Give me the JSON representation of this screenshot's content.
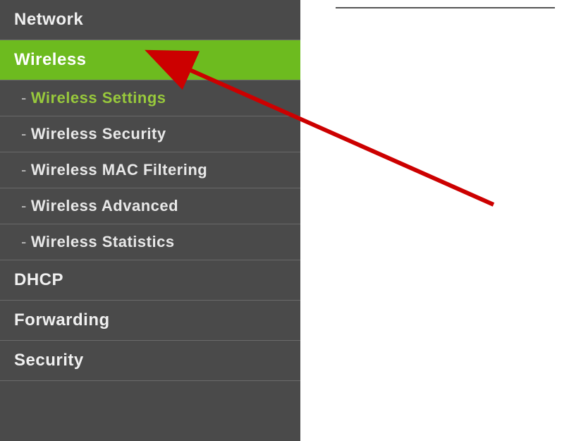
{
  "sidebar": {
    "items": [
      {
        "label": "Network",
        "type": "main",
        "active": false
      },
      {
        "label": "Wireless",
        "type": "main",
        "active": true
      },
      {
        "label": "Wireless Settings",
        "type": "sub",
        "selected": true
      },
      {
        "label": "Wireless Security",
        "type": "sub",
        "selected": false
      },
      {
        "label": "Wireless MAC Filtering",
        "type": "sub",
        "selected": false
      },
      {
        "label": "Wireless Advanced",
        "type": "sub",
        "selected": false
      },
      {
        "label": "Wireless Statistics",
        "type": "sub",
        "selected": false
      },
      {
        "label": "DHCP",
        "type": "main",
        "active": false
      },
      {
        "label": "Forwarding",
        "type": "main",
        "active": false
      },
      {
        "label": "Security",
        "type": "main",
        "active": false
      }
    ]
  },
  "colors": {
    "accent_green": "#6dbb1f",
    "highlight_text": "#98c93c",
    "sidebar_bg": "#4a4a4a",
    "arrow_red": "#cc0000"
  }
}
